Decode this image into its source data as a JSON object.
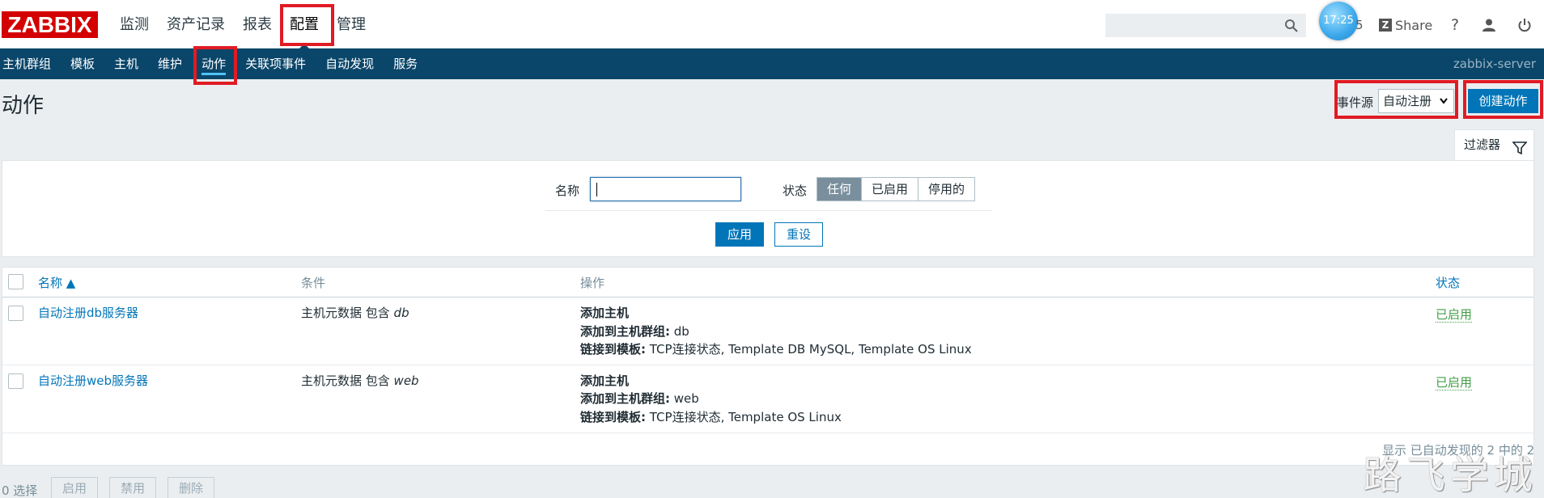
{
  "logo": "ZABBIX",
  "main_nav": [
    "监测",
    "资产记录",
    "报表",
    "配置",
    "管理"
  ],
  "search": {
    "value": ""
  },
  "clock_time": "17:25",
  "clock_fragment": "5",
  "share_label": "Share",
  "help_glyph": "?",
  "sub_nav": [
    "主机群组",
    "模板",
    "主机",
    "维护",
    "动作",
    "关联项事件",
    "自动发现",
    "服务"
  ],
  "server_name": "zabbix-server",
  "page_title": "动作",
  "event_source": {
    "label": "事件源",
    "selected": "自动注册"
  },
  "create_button": "创建动作",
  "filter": {
    "tab_label": "过滤器",
    "name_label": "名称",
    "name_value": "",
    "state_label": "状态",
    "state_options": [
      "任何",
      "已启用",
      "停用的"
    ],
    "apply": "应用",
    "reset": "重设"
  },
  "table": {
    "headers": {
      "name": "名称 ▲",
      "conditions": "条件",
      "operations": "操作",
      "status": "状态"
    },
    "rows": [
      {
        "name": "自动注册db服务器",
        "condition_prefix": "主机元数据 包含 ",
        "condition_value": "db",
        "ops": [
          {
            "label": "添加主机",
            "value": ""
          },
          {
            "label": "添加到主机群组:",
            "value": " db"
          },
          {
            "label": "链接到模板:",
            "value": " TCP连接状态, Template DB MySQL, Template OS Linux"
          }
        ],
        "status": "已启用"
      },
      {
        "name": "自动注册web服务器",
        "condition_prefix": "主机元数据 包含 ",
        "condition_value": "web",
        "ops": [
          {
            "label": "添加主机",
            "value": ""
          },
          {
            "label": "添加到主机群组:",
            "value": " web"
          },
          {
            "label": "链接到模板:",
            "value": " TCP连接状态, Template OS Linux"
          }
        ],
        "status": "已启用"
      }
    ],
    "footer": "显示 已自动发现的 2 中的 2"
  },
  "selection": {
    "count": "0 选择",
    "buttons": [
      "启用",
      "禁用",
      "删除"
    ]
  },
  "watermark": "路飞学城",
  "colors": {
    "header": "#0a466a",
    "accent": "#0275b8",
    "enabled": "#429e47",
    "logo": "#d40000",
    "highlight": "#e01b24"
  }
}
